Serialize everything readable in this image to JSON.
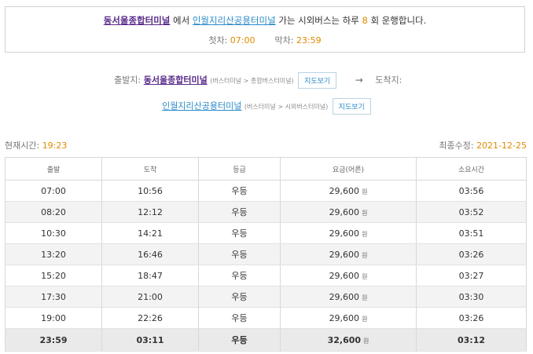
{
  "summary": {
    "origin": "동서울종합터미널",
    "text_from": "에서",
    "destination": "인월지리산공용터미널",
    "text_mid": "가는 시외버스는 하루",
    "count": "8",
    "text_end": "회 운행합니다.",
    "first_label": "첫차:",
    "first_time": "07:00",
    "last_label": "막차:",
    "last_time": "23:59"
  },
  "route": {
    "depart_label": "출발지:",
    "depart_name": "동서울종합터미널",
    "depart_path": "(버스터미널 > 종합버스터미널)",
    "map_button": "지도보기",
    "arrow": "→",
    "arrive_label": "도착지:",
    "arrive_name": "인월지리산공용터미널",
    "arrive_path": "(버스터미널 > 시외버스터미널)"
  },
  "current_time": {
    "label": "현재시간:",
    "value": "19:23"
  },
  "last_modified": {
    "label": "최종수정:",
    "value": "2021-12-25"
  },
  "table": {
    "headers": [
      "출발",
      "도착",
      "등급",
      "요금(어른)",
      "소요시간"
    ],
    "currency": "원",
    "rows": [
      [
        "07:00",
        "10:56",
        "우등",
        "29,600",
        "03:56"
      ],
      [
        "08:20",
        "12:12",
        "우등",
        "29,600",
        "03:52"
      ],
      [
        "10:30",
        "14:21",
        "우등",
        "29,600",
        "03:51"
      ],
      [
        "13:20",
        "16:46",
        "우등",
        "29,600",
        "03:26"
      ],
      [
        "15:20",
        "18:47",
        "우등",
        "29,600",
        "03:27"
      ],
      [
        "17:30",
        "21:00",
        "우등",
        "29,600",
        "03:30"
      ],
      [
        "19:00",
        "22:26",
        "우등",
        "29,600",
        "03:26"
      ],
      [
        "23:59",
        "03:11",
        "우등",
        "32,600",
        "03:12"
      ]
    ]
  }
}
